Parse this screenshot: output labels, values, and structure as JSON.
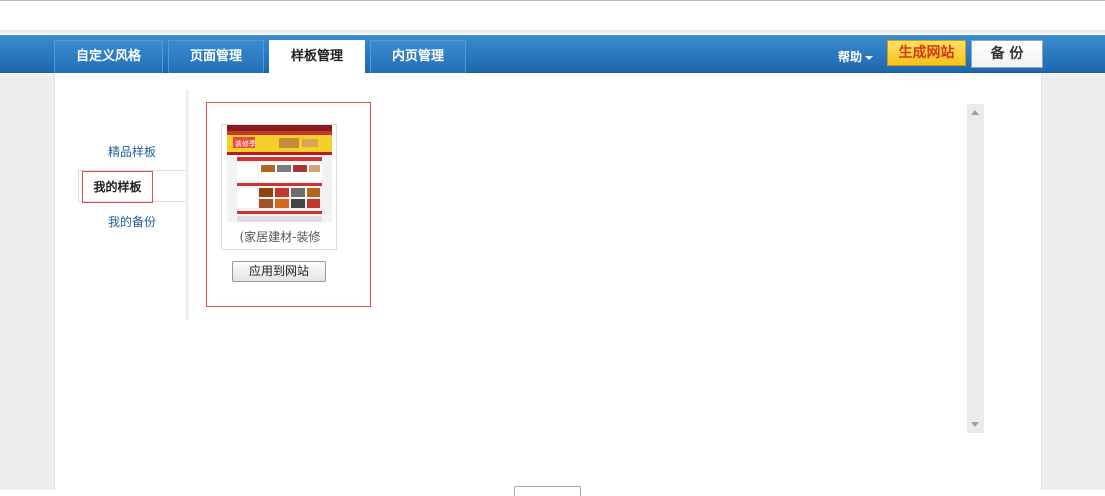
{
  "nav": {
    "tabs": [
      {
        "label": "自定义风格",
        "active": false
      },
      {
        "label": "页面管理",
        "active": false
      },
      {
        "label": "样板管理",
        "active": true
      },
      {
        "label": "内页管理",
        "active": false
      }
    ],
    "help_label": "帮助",
    "generate_label": "生成网站",
    "backup_label": "备 份"
  },
  "submenu": {
    "items": [
      {
        "label": "精品样板",
        "active": false
      },
      {
        "label": "我的样板",
        "active": true
      },
      {
        "label": "我的备份",
        "active": false
      }
    ]
  },
  "template_card": {
    "title": "(家居建材-装修",
    "apply_label": "应用到网站",
    "thumbnail_text": "装修季"
  },
  "colors": {
    "nav_blue": "#2b79bf",
    "generate_bg": "#f7c21a",
    "generate_text": "#d2390c",
    "selection_red": "#d9534f",
    "link_blue": "#1f5f99"
  }
}
